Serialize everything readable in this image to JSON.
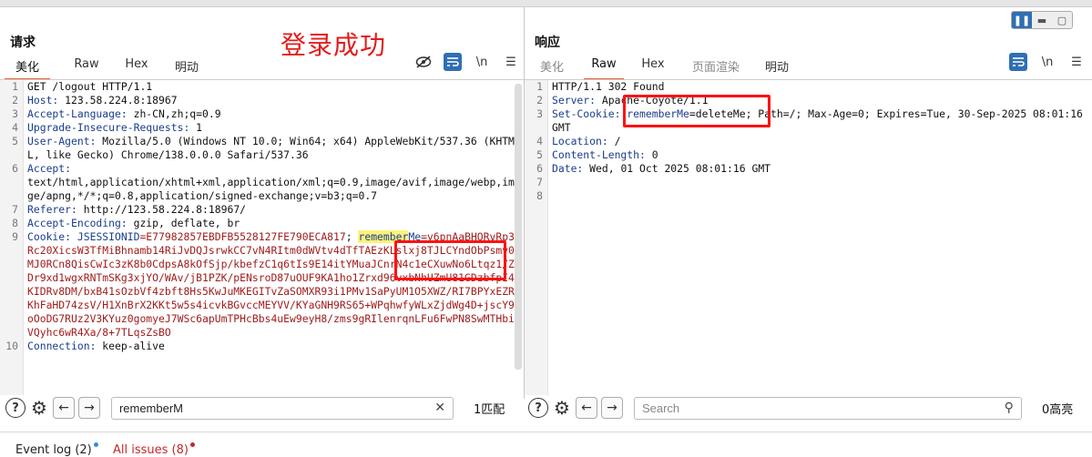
{
  "request": {
    "title": "请求",
    "tabs": [
      {
        "label": "美化",
        "active": true
      },
      {
        "label": "Raw",
        "active": false
      },
      {
        "label": "Hex",
        "active": false
      },
      {
        "label": "明动",
        "active": false
      }
    ],
    "toolbar_icons": [
      "eye-off-icon",
      "wrap-icon",
      "newline-icon",
      "menu-icon"
    ],
    "newline_label": "\\n",
    "lines": {
      "l1": "GET /logout HTTP/1.1",
      "l2_name": "Host:",
      "l2_val": " 123.58.224.8:18967",
      "l3_name": "Accept-Language:",
      "l3_val": " zh-CN,zh;q=0.9",
      "l4_name": "Upgrade-Insecure-Requests:",
      "l4_val": " 1",
      "l5_name": "User-Agent:",
      "l5_val": " Mozilla/5.0 (Windows NT 10.0; Win64; x64) AppleWebKit/537.36 (KHTML, like Gecko) Chrome/138.0.0.0 Safari/537.36",
      "l6_name": "Accept:",
      "l6_val": "text/html,application/xhtml+xml,application/xml;q=0.9,image/avif,image/webp,image/apng,*/*;q=0.8,application/signed-exchange;v=b3;q=0.7",
      "l7_name": "Referer:",
      "l7_val": " http://123.58.224.8:18967/",
      "l8_name": "Accept-Encoding:",
      "l8_val": " gzip, deflate, br",
      "l9_name": "Cookie:",
      "l9_sess_name": " JSESSIONID",
      "l9_sess_val": "=E77982857EBDFB5528127FE790ECA817",
      "l9_sep": "; ",
      "l9_hl": "remember",
      "l9_rest_name": "Me",
      "l9_val": "=y6pnAaBHORvRp3+Rc20XicsW3TfMiBhnamb14RiJvDQJsrwkCC7vN4RItm0dWVtv4dTfTAEzKLslxj8TJLCYndObPsmv0eMJ0RCn8QisCwIc3zK8b0CdpsA8kOfSjp/kbefzC1q6tIs9E14itYMuaJCnrN4c1eCXuwNo6Ltqz1/ZWDr9xd1wgxRNTmSKg3xjYO/WAv/jB1PZK/pENsroD87uOUF9KA1ho1Zrxd96vxbNhUZmU81GDzbfpI4SKIDRv8DM/bxB41sOzbVf4zbft8Hs5KwJuMKEGITvZaSOMXR93i1PMv1SaPyUM1O5XWZ/RI7BPYxEZRzKhFaHD74zsV/H1XnBrX2KKt5w5s4icvkBGvccMEYVV/KYaGNH9RS65+WPqhwfyWLxZjdWg4D+jscY9poOoDG7RUz2V3KYuz0gomyeJ7WSc6apUmTPHcBbs4uEw9eyH8/zms9gRIlenrqnLFu6FwPN8SwMTHbiBVQyhc6wR4Xa/8+7TLqsZsBO",
      "l10_name": "Connection:",
      "l10_val": " keep-alive"
    },
    "search": {
      "value": "rememberM",
      "placeholder": "Search",
      "match_count": "1匹配"
    }
  },
  "annotation": {
    "title": "登录成功",
    "color": "#e41b1b"
  },
  "response": {
    "title": "响应",
    "tabs": [
      {
        "label": "美化",
        "active": false,
        "disabled": true
      },
      {
        "label": "Raw",
        "active": true
      },
      {
        "label": "Hex",
        "active": false
      },
      {
        "label": "页面渲染",
        "active": false,
        "disabled": true
      },
      {
        "label": "明动",
        "active": false
      }
    ],
    "toolbar_icons": [
      "wrap-icon",
      "newline-icon",
      "menu-icon"
    ],
    "newline_label": "\\n",
    "lines": {
      "l1": "HTTP/1.1 302 Found",
      "l2_name": "Server:",
      "l2_val": " Apache-Coyote/1.1",
      "l3_name": "Set-Cookie:",
      "l3_cookie": " rememberMe",
      "l3_val": "=deleteMe; Path=/; Max-Age=0; Expires=Tue, 30-Sep-2025 08:01:16 GMT",
      "l4_name": "Location:",
      "l4_val": " /",
      "l5_name": "Content-Length:",
      "l5_val": " 0",
      "l6_name": "Date:",
      "l6_val": " Wed, 01 Oct 2025 08:01:16 GMT"
    },
    "search": {
      "value": "",
      "placeholder": "Search",
      "match_count": "0高亮"
    }
  },
  "statusbar": {
    "event_log": "Event log (2)",
    "all_issues": "All issues (8)",
    "event_dot_color": "#2f8fe0",
    "issues_color": "#c62828"
  },
  "line_numbers_left": [
    "1",
    "2",
    "3",
    "4",
    "5",
    "6",
    "7",
    "8",
    "9",
    "10"
  ],
  "line_numbers_right": [
    "1",
    "2",
    "3",
    "4",
    "5",
    "6",
    "7",
    "8"
  ]
}
